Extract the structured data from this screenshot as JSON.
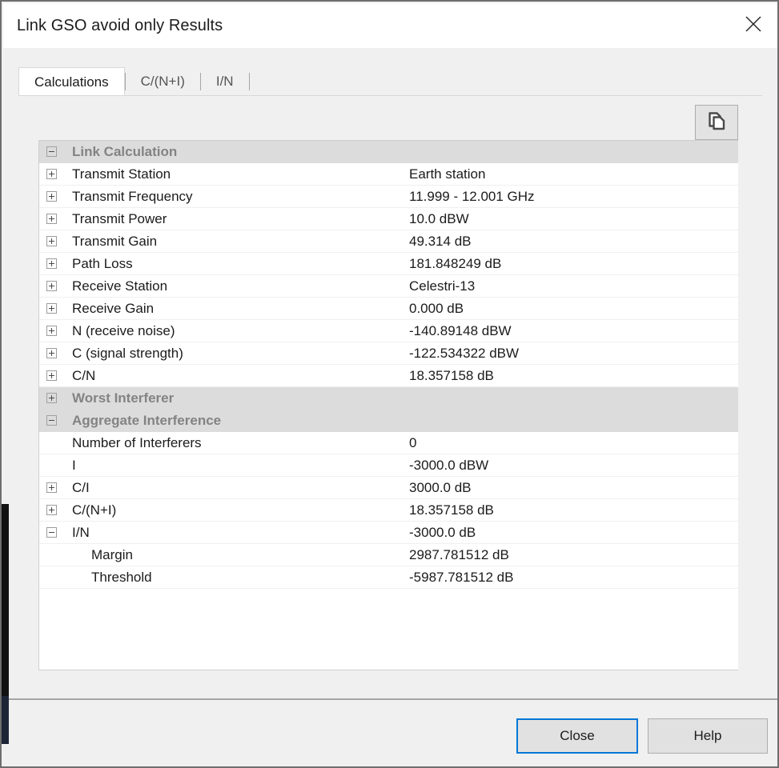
{
  "window": {
    "title": "Link GSO avoid only Results",
    "close_icon": "close-x-icon"
  },
  "tabs": [
    {
      "label": "Calculations",
      "active": true
    },
    {
      "label": "C/(N+I)",
      "active": false
    },
    {
      "label": "I/N",
      "active": false
    }
  ],
  "toolbar": {
    "copy_icon": "copy-pages-icon"
  },
  "tree": {
    "rows": [
      {
        "type": "group",
        "expander": "minus",
        "indent": 0,
        "label": "Link Calculation",
        "value": ""
      },
      {
        "type": "item",
        "expander": "plus",
        "indent": 0,
        "label": "Transmit Station",
        "value": "Earth station"
      },
      {
        "type": "item",
        "expander": "plus",
        "indent": 0,
        "label": "Transmit Frequency",
        "value": "11.999 - 12.001 GHz"
      },
      {
        "type": "item",
        "expander": "plus",
        "indent": 0,
        "label": "Transmit Power",
        "value": "10.0 dBW"
      },
      {
        "type": "item",
        "expander": "plus",
        "indent": 0,
        "label": "Transmit Gain",
        "value": "49.314 dB"
      },
      {
        "type": "item",
        "expander": "plus",
        "indent": 0,
        "label": "Path Loss",
        "value": "181.848249 dB"
      },
      {
        "type": "item",
        "expander": "plus",
        "indent": 0,
        "label": "Receive Station",
        "value": "Celestri-13"
      },
      {
        "type": "item",
        "expander": "plus",
        "indent": 0,
        "label": "Receive Gain",
        "value": "0.000 dB"
      },
      {
        "type": "item",
        "expander": "plus",
        "indent": 0,
        "label": "N (receive noise)",
        "value": "-140.89148 dBW"
      },
      {
        "type": "item",
        "expander": "plus",
        "indent": 0,
        "label": "C (signal strength)",
        "value": "-122.534322 dBW"
      },
      {
        "type": "item",
        "expander": "plus",
        "indent": 0,
        "label": "C/N",
        "value": "18.357158 dB"
      },
      {
        "type": "group",
        "expander": "plus",
        "indent": 0,
        "label": "Worst Interferer",
        "value": ""
      },
      {
        "type": "group",
        "expander": "minus",
        "indent": 0,
        "label": "Aggregate Interference",
        "value": ""
      },
      {
        "type": "item",
        "expander": "none",
        "indent": 0,
        "label": "Number of Interferers",
        "value": "0"
      },
      {
        "type": "item",
        "expander": "none",
        "indent": 0,
        "label": "I",
        "value": "-3000.0 dBW"
      },
      {
        "type": "item",
        "expander": "plus",
        "indent": 0,
        "label": "C/I",
        "value": "3000.0 dB"
      },
      {
        "type": "item",
        "expander": "plus",
        "indent": 0,
        "label": "C/(N+I)",
        "value": "18.357158 dB"
      },
      {
        "type": "item",
        "expander": "minus",
        "indent": 0,
        "label": "I/N",
        "value": "-3000.0 dB"
      },
      {
        "type": "item",
        "expander": "none",
        "indent": 1,
        "label": "Margin",
        "value": "2987.781512 dB"
      },
      {
        "type": "item",
        "expander": "none",
        "indent": 1,
        "label": "Threshold",
        "value": "-5987.781512 dB"
      }
    ]
  },
  "footer": {
    "close_label": "Close",
    "help_label": "Help"
  },
  "colors": {
    "accent": "#0078d7",
    "group_band": "#dcdcdc",
    "group_text": "#838383",
    "window_body": "#f0f0f0"
  }
}
